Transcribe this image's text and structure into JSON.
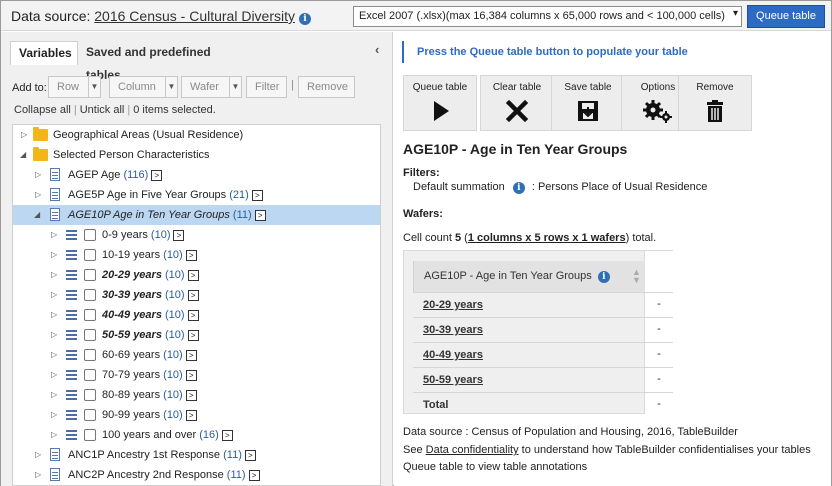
{
  "topbar": {
    "data_source_label": "Data source:",
    "data_source_name": "2016 Census - Cultural Diversity",
    "format_selected": "Excel 2007 (.xlsx)(max 16,384 columns x 65,000 rows and < 100,000 cells)",
    "queue_button": "Queue table"
  },
  "left": {
    "tabs": [
      "Variables",
      "Saved and predefined tables"
    ],
    "add_to_label": "Add to:",
    "toolbar": [
      "Row",
      "Column",
      "Wafer",
      "Filter",
      "Remove"
    ],
    "collapse_all": "Collapse all",
    "untick_all": "Untick all",
    "items_selected": "0 items selected.",
    "tree": [
      {
        "label": "Geographical Areas (Usual Residence)",
        "count": ""
      },
      {
        "label": "Selected Person Characteristics",
        "count": ""
      },
      {
        "label": "AGEP Age",
        "count": "(116)"
      },
      {
        "label": "AGE5P Age in Five Year Groups",
        "count": "(21)"
      },
      {
        "label": "AGE10P Age in Ten Year Groups",
        "count": "(11)"
      },
      {
        "label": "0-9 years",
        "count": "(10)"
      },
      {
        "label": "10-19 years",
        "count": "(10)"
      },
      {
        "label": "20-29 years",
        "count": "(10)"
      },
      {
        "label": "30-39 years",
        "count": "(10)"
      },
      {
        "label": "40-49 years",
        "count": "(10)"
      },
      {
        "label": "50-59 years",
        "count": "(10)"
      },
      {
        "label": "60-69 years",
        "count": "(10)"
      },
      {
        "label": "70-79 years",
        "count": "(10)"
      },
      {
        "label": "80-89 years",
        "count": "(10)"
      },
      {
        "label": "90-99 years",
        "count": "(10)"
      },
      {
        "label": "100 years and over",
        "count": "(16)"
      },
      {
        "label": "ANC1P Ancestry 1st Response",
        "count": "(11)"
      },
      {
        "label": "ANC2P Ancestry 2nd Response",
        "count": "(11)"
      }
    ]
  },
  "right": {
    "hint": "Press the Queue table button to populate your table",
    "actions": [
      "Queue table",
      "Clear table",
      "Save table",
      "Options",
      "Remove"
    ],
    "table_title": "AGE10P - Age in Ten Year Groups",
    "filters_heading": "Filters:",
    "filter_name": "Default summation",
    "filter_value": ": Persons Place of Usual Residence",
    "wafers_heading": "Wafers:",
    "cell_count_prefix": "Cell count",
    "cell_count_value": "5",
    "cell_count_link": "1 columns x 5 rows x 1 wafers",
    "cell_count_suffix": "total.",
    "column_header": "AGE10P - Age in Ten Year Groups",
    "rows": [
      {
        "label": "20-29 years",
        "value": "-"
      },
      {
        "label": "30-39 years",
        "value": "-"
      },
      {
        "label": "40-49 years",
        "value": "-"
      },
      {
        "label": "50-59 years",
        "value": "-"
      },
      {
        "label": "Total",
        "value": "-"
      }
    ],
    "footer": {
      "source": "Data source : Census of Population and Housing, 2016, TableBuilder",
      "see": "See",
      "confidentiality_link": "Data confidentiality",
      "confidentiality_rest": "to understand how TableBuilder confidentialises your tables",
      "annotations": "Queue table to view table annotations"
    }
  }
}
